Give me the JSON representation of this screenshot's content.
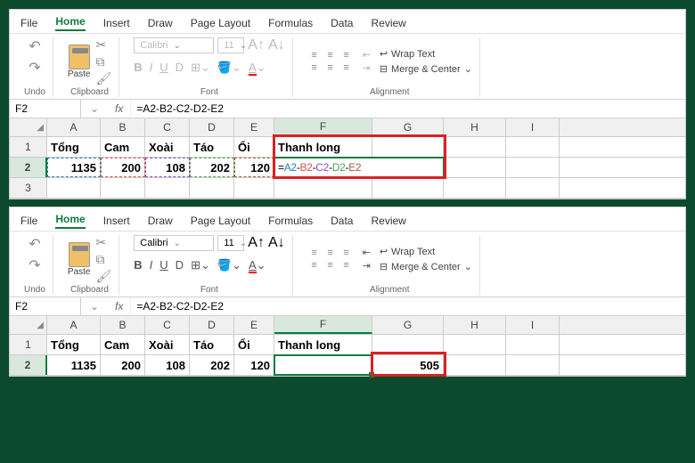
{
  "ribbon": {
    "file": "File",
    "home": "Home",
    "insert": "Insert",
    "draw": "Draw",
    "page": "Page Layout",
    "formulas": "Formulas",
    "data": "Data",
    "review": "Review"
  },
  "groups": {
    "undo": "Undo",
    "clipboard": "Clipboard",
    "font": "Font",
    "alignment": "Alignment",
    "paste": "Paste"
  },
  "font": {
    "name": "Calibri",
    "size": "11",
    "bold": "B",
    "italic": "I",
    "underline": "U",
    "strike": "D"
  },
  "align": {
    "wrap": "Wrap Text",
    "merge": "Merge & Center"
  },
  "fbar1": {
    "ref": "F2",
    "formula": "=A2-B2-C2-D2-E2"
  },
  "fbar2": {
    "ref": "F2",
    "formula": "=A2-B2-C2-D2-E2"
  },
  "cols": [
    "A",
    "B",
    "C",
    "D",
    "E",
    "F",
    "G",
    "H",
    "I"
  ],
  "rows": [
    "1",
    "2",
    "3"
  ],
  "data1": {
    "r1": [
      "Tổng",
      "Cam",
      "Xoài",
      "Táo",
      "Ổi",
      "Thanh long"
    ],
    "r2": [
      "1135",
      "200",
      "108",
      "202",
      "120"
    ]
  },
  "formula_parts": {
    "eq": "=",
    "a2": "A2",
    "m1": "-",
    "b2": "B2",
    "m2": "-",
    "c2": "C2",
    "m3": "-",
    "d2": "D2",
    "m4": "-",
    "e2": "E2"
  },
  "data2": {
    "r1": [
      "Tổng",
      "Cam",
      "Xoài",
      "Táo",
      "Ổi",
      "Thanh long"
    ],
    "r2": [
      "1135",
      "200",
      "108",
      "202",
      "120",
      "",
      "505"
    ]
  }
}
